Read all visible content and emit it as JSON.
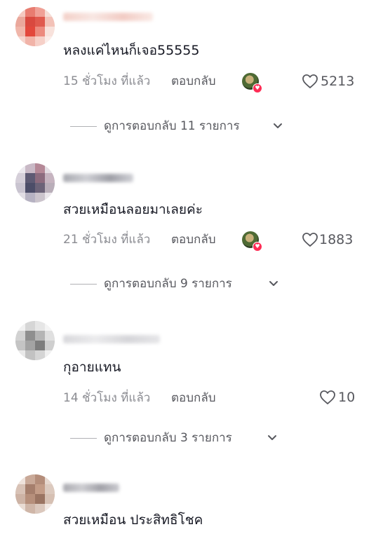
{
  "comments": [
    {
      "text": "หลงแค่ไหนก็เจอ55555",
      "time": "15 ชั่วโมง ที่แล้ว",
      "reply_label": "ตอบกลับ",
      "liked_by_creator": true,
      "likes": "5213",
      "view_replies": "ดูการตอบกลับ 11 รายการ"
    },
    {
      "text": "สวยเหมือนลอยมาเลยค่ะ",
      "time": "21 ชั่วโมง ที่แล้ว",
      "reply_label": "ตอบกลับ",
      "liked_by_creator": true,
      "likes": "1883",
      "view_replies": "ดูการตอบกลับ 9 รายการ"
    },
    {
      "text": "กุอายแทน",
      "time": "14 ชั่วโมง ที่แล้ว",
      "reply_label": "ตอบกลับ",
      "liked_by_creator": false,
      "likes": "10",
      "view_replies": "ดูการตอบกลับ 3 รายการ"
    },
    {
      "text": "สวยเหมือน ประสิทธิโชค"
    }
  ],
  "colors": {
    "text_primary": "#161823",
    "text_secondary": "#8a8b91",
    "accent_heart": "#fe2c55"
  },
  "icons": {
    "like": "heart-outline-icon",
    "expand": "chevron-down-icon",
    "creator_like": "heart-badge-icon"
  }
}
